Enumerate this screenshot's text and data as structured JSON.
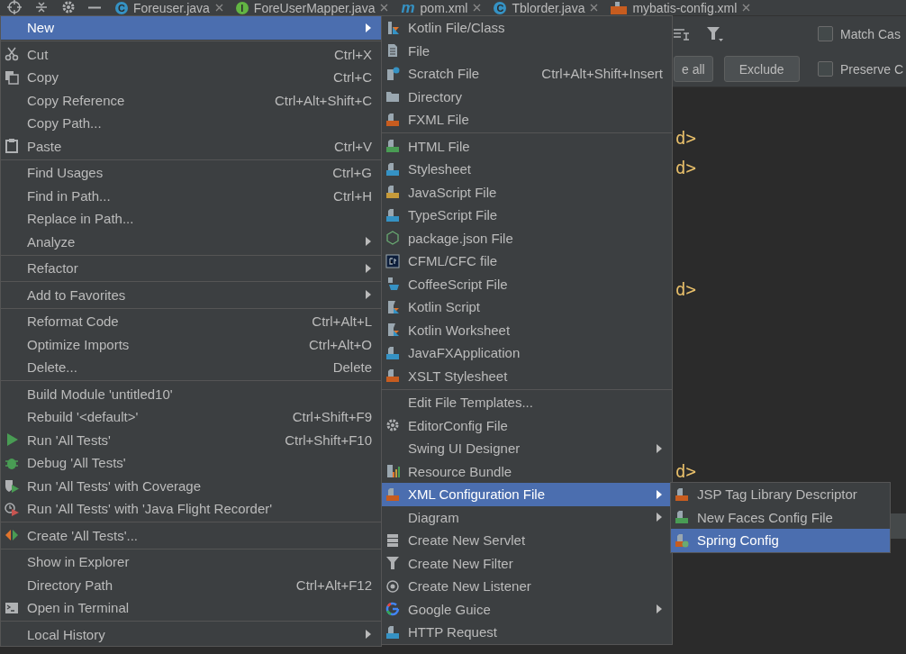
{
  "tabs": [
    {
      "label": "Foreuser.java",
      "badge": "C",
      "kind": "class"
    },
    {
      "label": "ForeUserMapper.java",
      "badge": "I",
      "kind": "interface"
    },
    {
      "label": "pom.xml",
      "badge": "m",
      "kind": "maven"
    },
    {
      "label": "Tblorder.java",
      "badge": "C",
      "kind": "class"
    },
    {
      "label": "mybatis-config.xml",
      "kind": "xml"
    }
  ],
  "find_bar": {
    "buttons": [
      "e all",
      "Exclude"
    ],
    "options": [
      {
        "label": "Match Cas",
        "checked": false
      },
      {
        "label": "Preserve C",
        "checked": false
      }
    ]
  },
  "code_lines": [
    "d>",
    "d>",
    "d>",
    "d>"
  ],
  "context_menu": [
    {
      "kind": "item",
      "label": "New",
      "submenu": true,
      "selected": true
    },
    {
      "kind": "separator"
    },
    {
      "kind": "item",
      "label": "Cut",
      "shortcut": "Ctrl+X",
      "selected": false
    },
    {
      "kind": "item",
      "label": "Copy",
      "shortcut": "Ctrl+C",
      "selected": false
    },
    {
      "kind": "item",
      "label": "Copy Reference",
      "shortcut": "Ctrl+Alt+Shift+C",
      "selected": false
    },
    {
      "kind": "item",
      "label": "Copy Path...",
      "selected": false
    },
    {
      "kind": "item",
      "label": "Paste",
      "shortcut": "Ctrl+V",
      "selected": false
    },
    {
      "kind": "separator"
    },
    {
      "kind": "item",
      "label": "Find Usages",
      "shortcut": "Ctrl+G",
      "selected": false
    },
    {
      "kind": "item",
      "label": "Find in Path...",
      "shortcut": "Ctrl+H",
      "selected": false
    },
    {
      "kind": "item",
      "label": "Replace in Path...",
      "selected": false
    },
    {
      "kind": "item",
      "label": "Analyze",
      "submenu": true,
      "selected": false
    },
    {
      "kind": "separator"
    },
    {
      "kind": "item",
      "label": "Refactor",
      "submenu": true,
      "selected": false
    },
    {
      "kind": "separator"
    },
    {
      "kind": "item",
      "label": "Add to Favorites",
      "submenu": true,
      "selected": false
    },
    {
      "kind": "separator"
    },
    {
      "kind": "item",
      "label": "Reformat Code",
      "shortcut": "Ctrl+Alt+L",
      "selected": false
    },
    {
      "kind": "item",
      "label": "Optimize Imports",
      "shortcut": "Ctrl+Alt+O",
      "selected": false
    },
    {
      "kind": "item",
      "label": "Delete...",
      "shortcut": "Delete",
      "selected": false
    },
    {
      "kind": "separator"
    },
    {
      "kind": "item",
      "label": "Build Module 'untitled10'",
      "selected": false
    },
    {
      "kind": "item",
      "label": "Rebuild '<default>'",
      "shortcut": "Ctrl+Shift+F9",
      "selected": false
    },
    {
      "kind": "item",
      "label": "Run 'All Tests'",
      "shortcut": "Ctrl+Shift+F10",
      "selected": false
    },
    {
      "kind": "item",
      "label": "Debug 'All Tests'",
      "selected": false
    },
    {
      "kind": "item",
      "label": "Run 'All Tests' with Coverage",
      "selected": false
    },
    {
      "kind": "item",
      "label": "Run 'All Tests' with 'Java Flight Recorder'",
      "selected": false
    },
    {
      "kind": "separator"
    },
    {
      "kind": "item",
      "label": "Create 'All Tests'...",
      "selected": false
    },
    {
      "kind": "separator"
    },
    {
      "kind": "item",
      "label": "Show in Explorer",
      "selected": false
    },
    {
      "kind": "item",
      "label": "Directory Path",
      "shortcut": "Ctrl+Alt+F12",
      "selected": false
    },
    {
      "kind": "item",
      "label": "Open in Terminal",
      "selected": false
    },
    {
      "kind": "separator"
    },
    {
      "kind": "item",
      "label": "Local History",
      "submenu": true,
      "selected": false
    }
  ],
  "new_menu": [
    {
      "kind": "item",
      "label": "Kotlin File/Class",
      "selected": false
    },
    {
      "kind": "item",
      "label": "File",
      "selected": false
    },
    {
      "kind": "item",
      "label": "Scratch File",
      "shortcut": "Ctrl+Alt+Shift+Insert",
      "selected": false
    },
    {
      "kind": "item",
      "label": "Directory",
      "selected": false
    },
    {
      "kind": "item",
      "label": "FXML File",
      "selected": false
    },
    {
      "kind": "separator"
    },
    {
      "kind": "item",
      "label": "HTML File",
      "selected": false
    },
    {
      "kind": "item",
      "label": "Stylesheet",
      "selected": false
    },
    {
      "kind": "item",
      "label": "JavaScript File",
      "selected": false
    },
    {
      "kind": "item",
      "label": "TypeScript File",
      "selected": false
    },
    {
      "kind": "item",
      "label": "package.json File",
      "selected": false
    },
    {
      "kind": "item",
      "label": "CFML/CFC file",
      "selected": false
    },
    {
      "kind": "item",
      "label": "CoffeeScript File",
      "selected": false
    },
    {
      "kind": "item",
      "label": "Kotlin Script",
      "selected": false
    },
    {
      "kind": "item",
      "label": "Kotlin Worksheet",
      "selected": false
    },
    {
      "kind": "item",
      "label": "JavaFXApplication",
      "selected": false
    },
    {
      "kind": "item",
      "label": "XSLT Stylesheet",
      "selected": false
    },
    {
      "kind": "separator"
    },
    {
      "kind": "item",
      "label": "Edit File Templates...",
      "selected": false
    },
    {
      "kind": "item",
      "label": "EditorConfig File",
      "selected": false
    },
    {
      "kind": "item",
      "label": "Swing UI Designer",
      "submenu": true,
      "selected": false
    },
    {
      "kind": "item",
      "label": "Resource Bundle",
      "selected": false
    },
    {
      "kind": "item",
      "label": "XML Configuration File",
      "submenu": true,
      "selected": true
    },
    {
      "kind": "item",
      "label": "Diagram",
      "submenu": true,
      "selected": false
    },
    {
      "kind": "item",
      "label": "Create New Servlet",
      "selected": false
    },
    {
      "kind": "item",
      "label": "Create New Filter",
      "selected": false
    },
    {
      "kind": "item",
      "label": "Create New Listener",
      "selected": false
    },
    {
      "kind": "item",
      "label": "Google Guice",
      "submenu": true,
      "selected": false
    },
    {
      "kind": "item",
      "label": "HTTP Request",
      "selected": false
    }
  ],
  "xml_menu": [
    {
      "kind": "item",
      "label": "JSP Tag Library Descriptor",
      "selected": false
    },
    {
      "kind": "item",
      "label": "New Faces Config File",
      "selected": false
    },
    {
      "kind": "item",
      "label": "Spring Config",
      "selected": true
    }
  ]
}
